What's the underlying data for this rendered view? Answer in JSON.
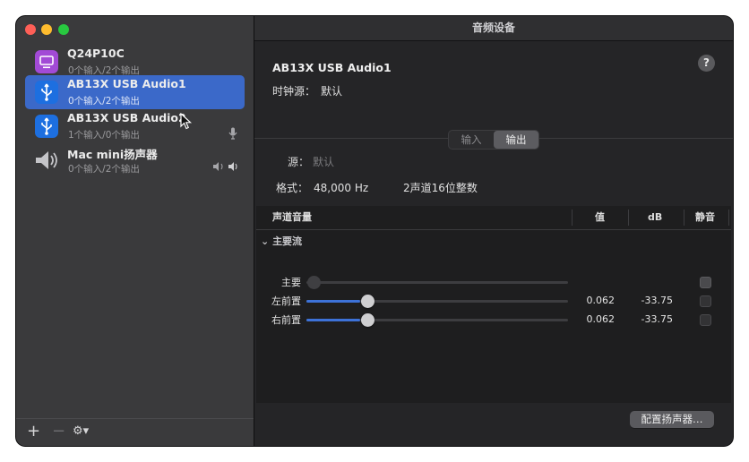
{
  "window": {
    "title": "音频设备"
  },
  "devices": [
    {
      "name": "Q24P10C",
      "subtitle": "0个输入/2个输出",
      "icon": "monitor-icon",
      "icon_color": "#a24ad6",
      "selected": false,
      "side": ""
    },
    {
      "name": "AB13X USB Audio1",
      "subtitle": "0个输入/2个输出",
      "icon": "usb-icon",
      "icon_color": "#1d6fe0",
      "selected": true,
      "side": ""
    },
    {
      "name": "AB13X USB Audio2",
      "subtitle": "1个输入/0个输出",
      "icon": "usb-icon",
      "icon_color": "#1d6fe0",
      "selected": false,
      "side": "🎙"
    },
    {
      "name": "Mac mini扬声器",
      "subtitle": "0个输入/2个输出",
      "icon": "speaker-icon",
      "icon_color": "#b8b8bc",
      "selected": false,
      "side": "🔊"
    }
  ],
  "sidebar_bottom": {
    "add": "+",
    "remove": "−",
    "settings": "⚙▾"
  },
  "detail": {
    "device_title": "AB13X USB Audio1",
    "clock_label": "时钟源：",
    "clock_value": "默认",
    "help": "?",
    "tabs": {
      "input": "输入",
      "output": "输出",
      "active": "output"
    },
    "source_label": "源：",
    "source_value": "默认",
    "format_label": "格式：",
    "format_rate": "48,000 Hz",
    "format_channels": "2声道16位整数"
  },
  "table": {
    "headers": {
      "channel_volume": "声道音量",
      "value": "值",
      "db": "dB",
      "mute": "静音"
    },
    "group": "主要流",
    "rows": [
      {
        "label": "主要",
        "value": "",
        "db": "",
        "level": 0,
        "enabled": false
      },
      {
        "label": "左前置",
        "value": "0.062",
        "db": "-33.75",
        "level": 0.062,
        "enabled": true
      },
      {
        "label": "右前置",
        "value": "0.062",
        "db": "-33.75",
        "level": 0.062,
        "enabled": true
      }
    ]
  },
  "configure_button": "配置扬声器…",
  "colors": {
    "accent": "#3b69c9",
    "slider_fill": "#3d72d8"
  }
}
